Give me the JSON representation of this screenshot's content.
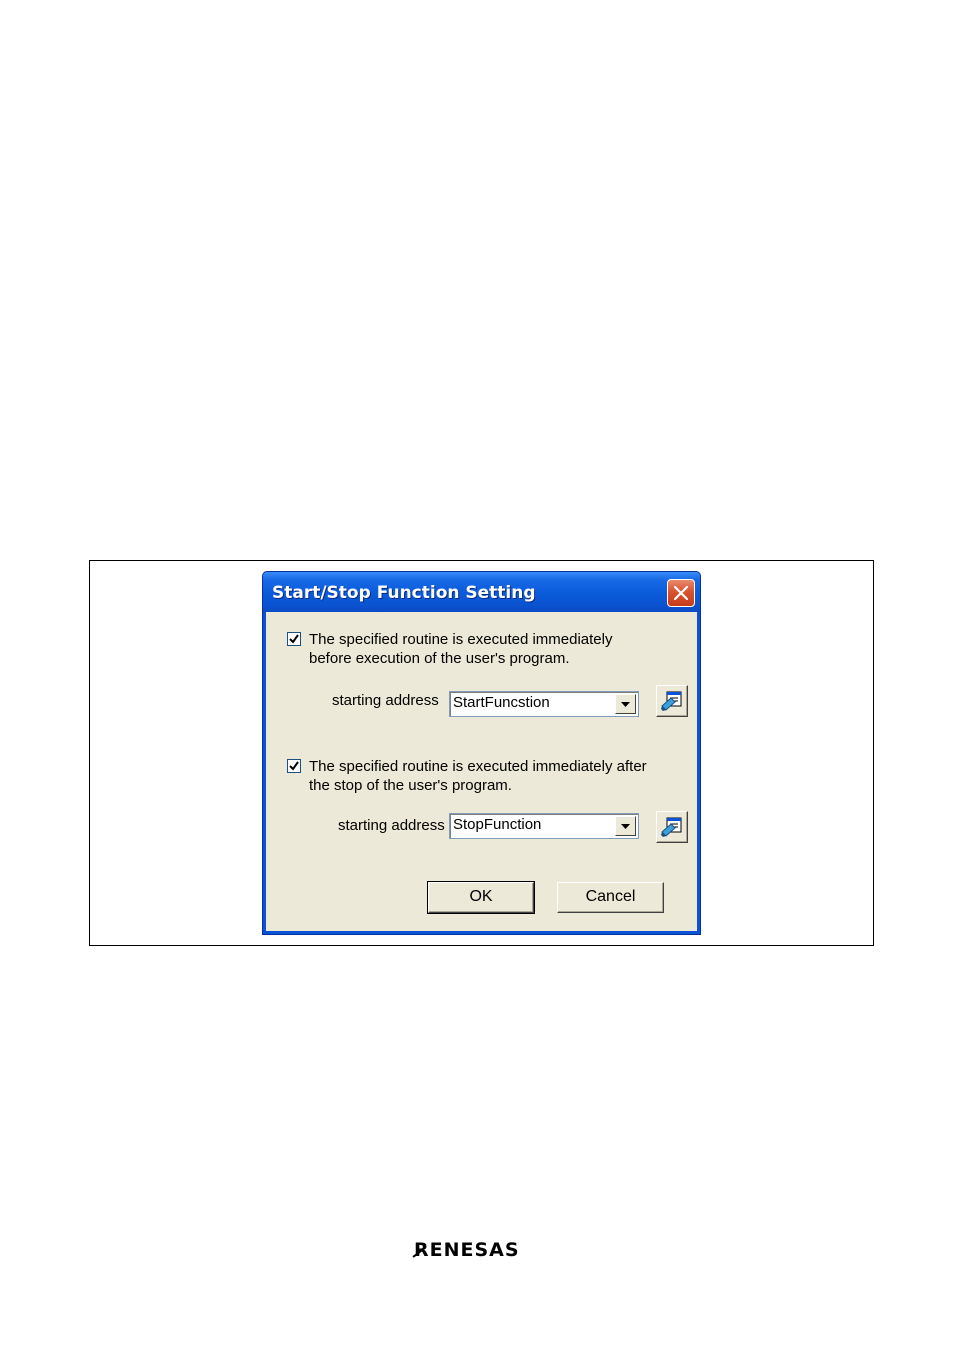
{
  "dialog": {
    "title": "Start/Stop Function Setting",
    "start_section": {
      "checked": true,
      "description_line1": "The specified routine is executed immediately",
      "description_line2": "before execution of the user's program.",
      "address_label": "starting address",
      "address_value": "StartFuncstion"
    },
    "stop_section": {
      "checked": true,
      "description_line1": "The specified routine is executed immediately after",
      "description_line2": "the stop of the user's  program.",
      "address_label": "starting address",
      "address_value": "StopFunction"
    },
    "ok_label": "OK",
    "cancel_label": "Cancel"
  },
  "footer": {
    "logo_text": "RENESAS"
  },
  "icons": {
    "close": "close-icon",
    "check": "checkmark-icon",
    "dropdown": "chevron-down-icon",
    "browse": "browse-symbol-icon"
  },
  "colors": {
    "titlebar": "#0a52d6",
    "client": "#ece9d8",
    "close": "#d9532f"
  }
}
